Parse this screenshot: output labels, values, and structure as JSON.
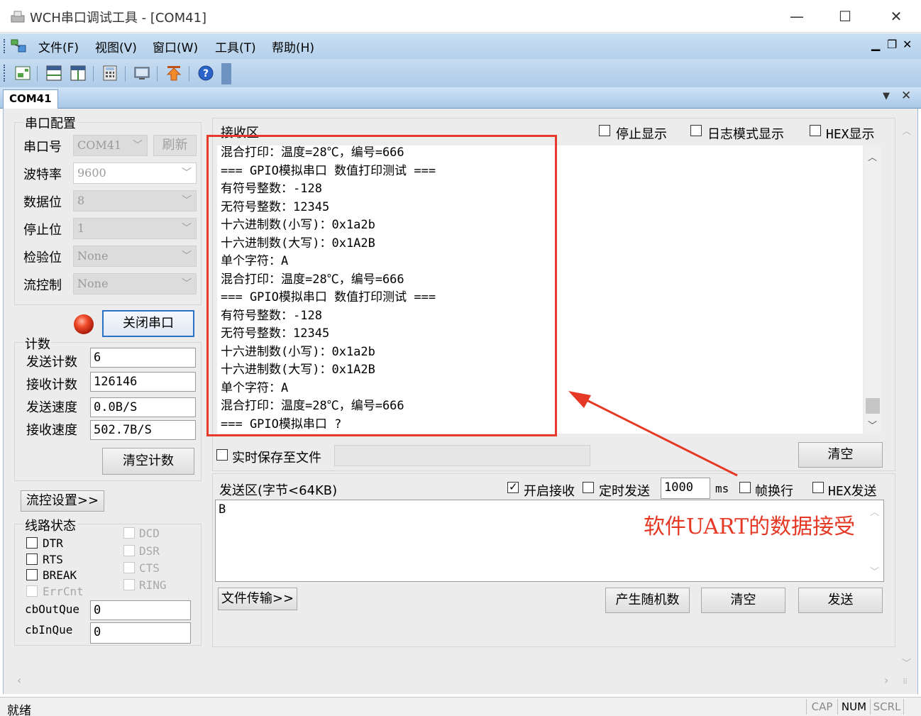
{
  "window": {
    "title": "WCH串口调试工具 - [COM41]",
    "minimize": "—",
    "maximize": "☐",
    "close": "✕"
  },
  "menu": {
    "items": [
      "文件(F)",
      "视图(V)",
      "窗口(W)",
      "工具(T)",
      "帮助(H)"
    ],
    "mdi_min": "▁",
    "mdi_restore": "❐",
    "mdi_close": "✕"
  },
  "toolbar": {
    "icons": [
      "new-connection-icon",
      "horizontal-layout-icon",
      "vertical-layout-icon",
      "calculator-icon",
      "monitor-icon",
      "upload-icon",
      "help-icon"
    ]
  },
  "doc_tab": {
    "label": "COM41"
  },
  "port_config": {
    "group_title": "串口配置",
    "port_label": "串口号",
    "port_value": "COM41",
    "refresh_label": "刷新",
    "baud_label": "波特率",
    "baud_value": "9600",
    "databits_label": "数据位",
    "databits_value": "8",
    "stopbits_label": "停止位",
    "stopbits_value": "1",
    "parity_label": "检验位",
    "parity_value": "None",
    "flow_label": "流控制",
    "flow_value": "None",
    "close_port_label": "关闭串口",
    "port_led_color": "#e0321d"
  },
  "counter": {
    "group_title": "计数",
    "send_count_label": "发送计数",
    "send_count_value": "6",
    "recv_count_label": "接收计数",
    "recv_count_value": "126146",
    "send_speed_label": "发送速度",
    "send_speed_value": "0.0B/S",
    "recv_speed_label": "接收速度",
    "recv_speed_value": "502.7B/S",
    "clear_count_label": "清空计数"
  },
  "flow_settings_label": "流控设置>>",
  "line_status": {
    "group_title": "线路状态",
    "dtr": "DTR",
    "rts": "RTS",
    "break": "BREAK",
    "errcnt": "ErrCnt",
    "dcd": "DCD",
    "dsr": "DSR",
    "cts": "CTS",
    "ring": "RING",
    "cboutque_label": "cbOutQue",
    "cboutque_value": "0",
    "cbinque_label": "cbInQue",
    "cbinque_value": "0"
  },
  "receive": {
    "title": "接收区",
    "stop_display": "停止显示",
    "log_mode": "日志模式显示",
    "hex_display": "HEX显示",
    "lines": [
      "混合打印：温度=28℃，编号=666",
      "=== GPIO模拟串口 数值打印测试 ===",
      "有符号整数：-128",
      "无符号整数：12345",
      "十六进制数(小写)：0x1a2b",
      "十六进制数(大写)：0x1A2B",
      "单个字符：A",
      "混合打印：温度=28℃，编号=666",
      "=== GPIO模拟串口 数值打印测试 ===",
      "有符号整数：-128",
      "无符号整数：12345",
      "十六进制数(小写)：0x1a2b",
      "十六进制数(大写)：0x1A2B",
      "单个字符：A",
      "混合打印：温度=28℃，编号=666",
      "=== GPIO模拟串口 ?"
    ],
    "save_to_file": "实时保存至文件",
    "clear_label": "清空"
  },
  "send": {
    "title": "发送区(字节<64KB)",
    "enable_receive": "开启接收",
    "timed_send": "定时发送",
    "interval_value": "1000",
    "interval_unit": "ms",
    "line_break": "帧换行",
    "hex_send": "HEX发送",
    "content": "B",
    "file_transfer": "文件传输>>",
    "random_label": "产生随机数",
    "clear_label": "清空",
    "send_label": "发送"
  },
  "annotation": {
    "text": "软件UART的数据接受",
    "color": "#e53825"
  },
  "status": {
    "ready": "就绪",
    "cap": "CAP",
    "num": "NUM",
    "scrl": "SCRL"
  }
}
